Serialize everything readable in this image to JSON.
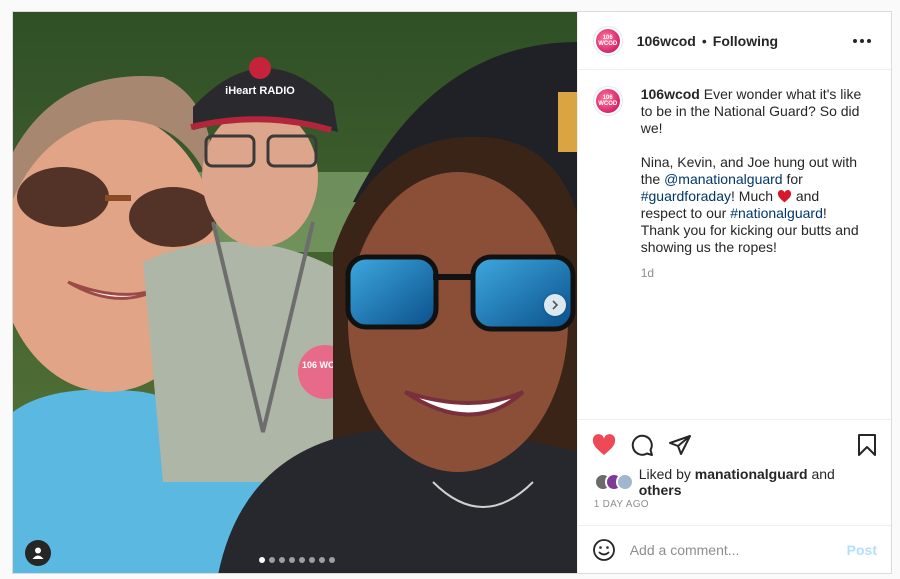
{
  "post": {
    "username": "106wcod",
    "follow_status": "Following",
    "avatar_text": "106 WCOD",
    "caption": {
      "username": "106wcod",
      "line1": "Ever wonder what it's like to be in the National Guard? So did we!",
      "line2_prefix": "Nina, Kevin, and Joe hung out with the",
      "mention": "@manationalguard",
      "line2_for": "for",
      "hashtag1": "#guardforaday",
      "line2_much": "! Much",
      "line2_respect": "and respect to our",
      "hashtag2": "#nationalguard",
      "line2_end": "! Thank you for kicking our butts and showing us the ropes!"
    },
    "time_ago": "1d",
    "liked_by_prefix": "Liked by",
    "liked_by_user": "manationalguard",
    "liked_by_and": "and",
    "liked_by_others": "others",
    "date_label": "1 DAY AGO",
    "comment_placeholder": "Add a comment...",
    "post_label": "Post",
    "carousel": {
      "count": 8,
      "active_index": 0
    },
    "photo_texts": {
      "cap_logo": "iHeart RADIO",
      "shirt_logo": "106 WCOD"
    }
  },
  "icons": [
    "heart-icon",
    "comment-icon",
    "share-icon",
    "bookmark-icon",
    "emoji-icon",
    "more-options-icon",
    "chevron-right-icon",
    "user-tag-icon"
  ],
  "colors": {
    "like_red": "#ed4956",
    "link_blue": "#00376b",
    "post_disabled": "#b2dffc"
  }
}
